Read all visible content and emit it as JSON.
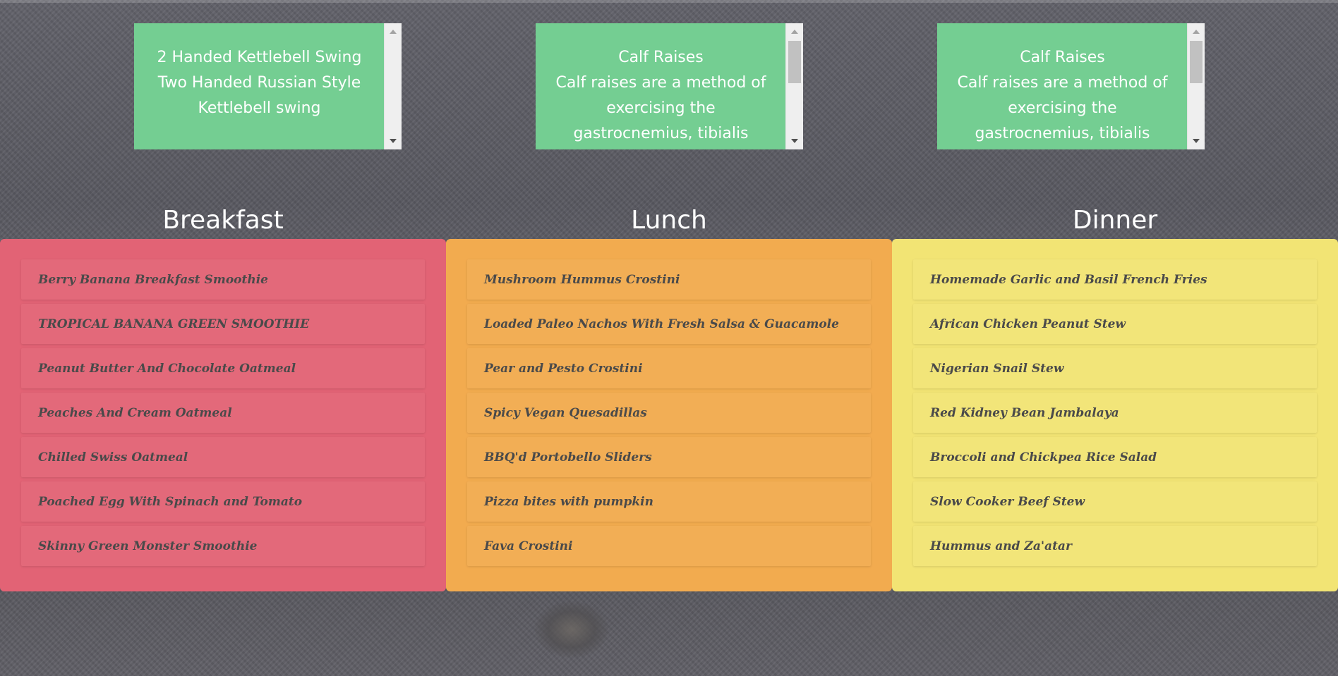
{
  "colors": {
    "exercise_card": "#74ce92",
    "breakfast_panel": "#e26375",
    "lunch_panel": "#f2ab4f",
    "dinner_panel": "#f2e474",
    "item_text": "#4a4a4a",
    "heading_text": "#ffffff"
  },
  "exercises": [
    {
      "title": "2 Handed Kettlebell Swing",
      "description": "Two Handed Russian Style Kettlebell swing"
    },
    {
      "title": "Calf Raises",
      "description": "Calf raises are a method of exercising the gastrocnemius, tibialis"
    },
    {
      "title": "Calf Raises",
      "description": "Calf raises are a method of exercising the gastrocnemius, tibialis"
    }
  ],
  "meals": {
    "breakfast": {
      "heading": "Breakfast",
      "items": [
        "Berry Banana Breakfast Smoothie",
        "TROPICAL BANANA GREEN SMOOTHIE",
        "Peanut Butter And Chocolate Oatmeal",
        "Peaches And Cream Oatmeal",
        "Chilled Swiss Oatmeal",
        "Poached Egg With Spinach and Tomato",
        "Skinny Green Monster Smoothie"
      ]
    },
    "lunch": {
      "heading": "Lunch",
      "items": [
        "Mushroom Hummus Crostini",
        "Loaded Paleo Nachos With Fresh Salsa & Guacamole",
        "Pear and Pesto Crostini",
        "Spicy Vegan Quesadillas",
        "BBQ'd Portobello Sliders",
        "Pizza bites with pumpkin",
        "Fava Crostini"
      ]
    },
    "dinner": {
      "heading": "Dinner",
      "items": [
        "Homemade Garlic and Basil French Fries",
        "African Chicken Peanut Stew",
        "Nigerian Snail Stew",
        "Red Kidney Bean Jambalaya",
        "Broccoli and Chickpea Rice Salad",
        "Slow Cooker Beef Stew",
        "Hummus and Za'atar"
      ]
    }
  }
}
